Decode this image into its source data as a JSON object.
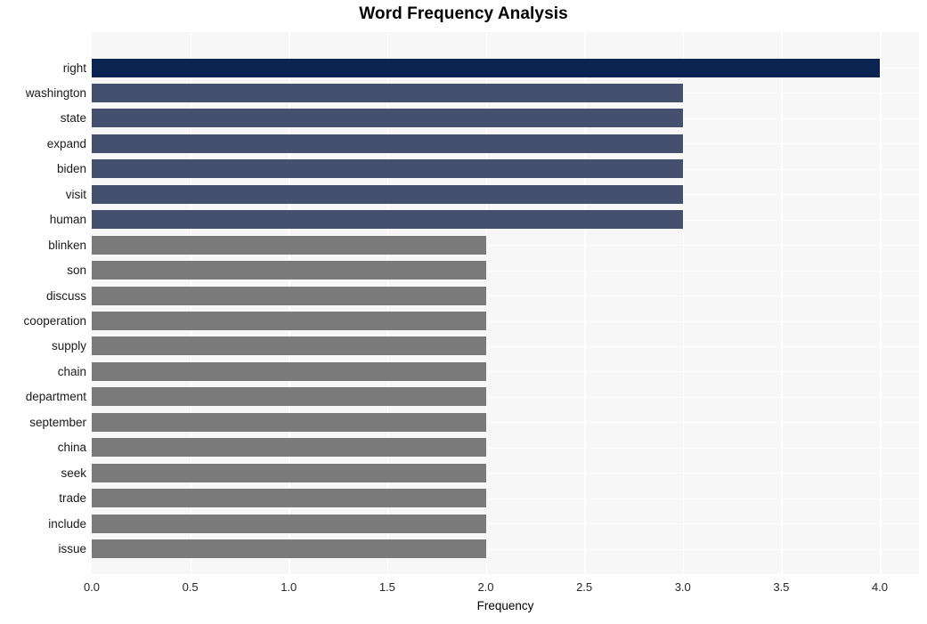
{
  "chart_data": {
    "type": "bar",
    "orientation": "horizontal",
    "title": "Word Frequency Analysis",
    "xlabel": "Frequency",
    "ylabel": "",
    "categories": [
      "right",
      "washington",
      "state",
      "expand",
      "biden",
      "visit",
      "human",
      "blinken",
      "son",
      "discuss",
      "cooperation",
      "supply",
      "chain",
      "department",
      "september",
      "china",
      "seek",
      "trade",
      "include",
      "issue"
    ],
    "values": [
      4,
      3,
      3,
      3,
      3,
      3,
      3,
      2,
      2,
      2,
      2,
      2,
      2,
      2,
      2,
      2,
      2,
      2,
      2,
      2
    ],
    "bar_colors": [
      "#0a2351",
      "#45506e",
      "#45506e",
      "#45506e",
      "#45506e",
      "#45506e",
      "#45506e",
      "#7a7a7a",
      "#7a7a7a",
      "#7a7a7a",
      "#7a7a7a",
      "#7a7a7a",
      "#7a7a7a",
      "#7a7a7a",
      "#7a7a7a",
      "#7a7a7a",
      "#7a7a7a",
      "#7a7a7a",
      "#7a7a7a",
      "#7a7a7a"
    ],
    "xlim": [
      0.0,
      4.0
    ],
    "xticks": [
      0.0,
      0.5,
      1.0,
      1.5,
      2.0,
      2.5,
      3.0,
      3.5,
      4.0
    ],
    "xtick_labels": [
      "0.0",
      "0.5",
      "1.0",
      "1.5",
      "2.0",
      "2.5",
      "3.0",
      "3.5",
      "4.0"
    ],
    "grid": true,
    "grid_color": "#ffffff",
    "plot_background": "#f7f7f7",
    "figure_background": "#ffffff",
    "legend": null
  }
}
